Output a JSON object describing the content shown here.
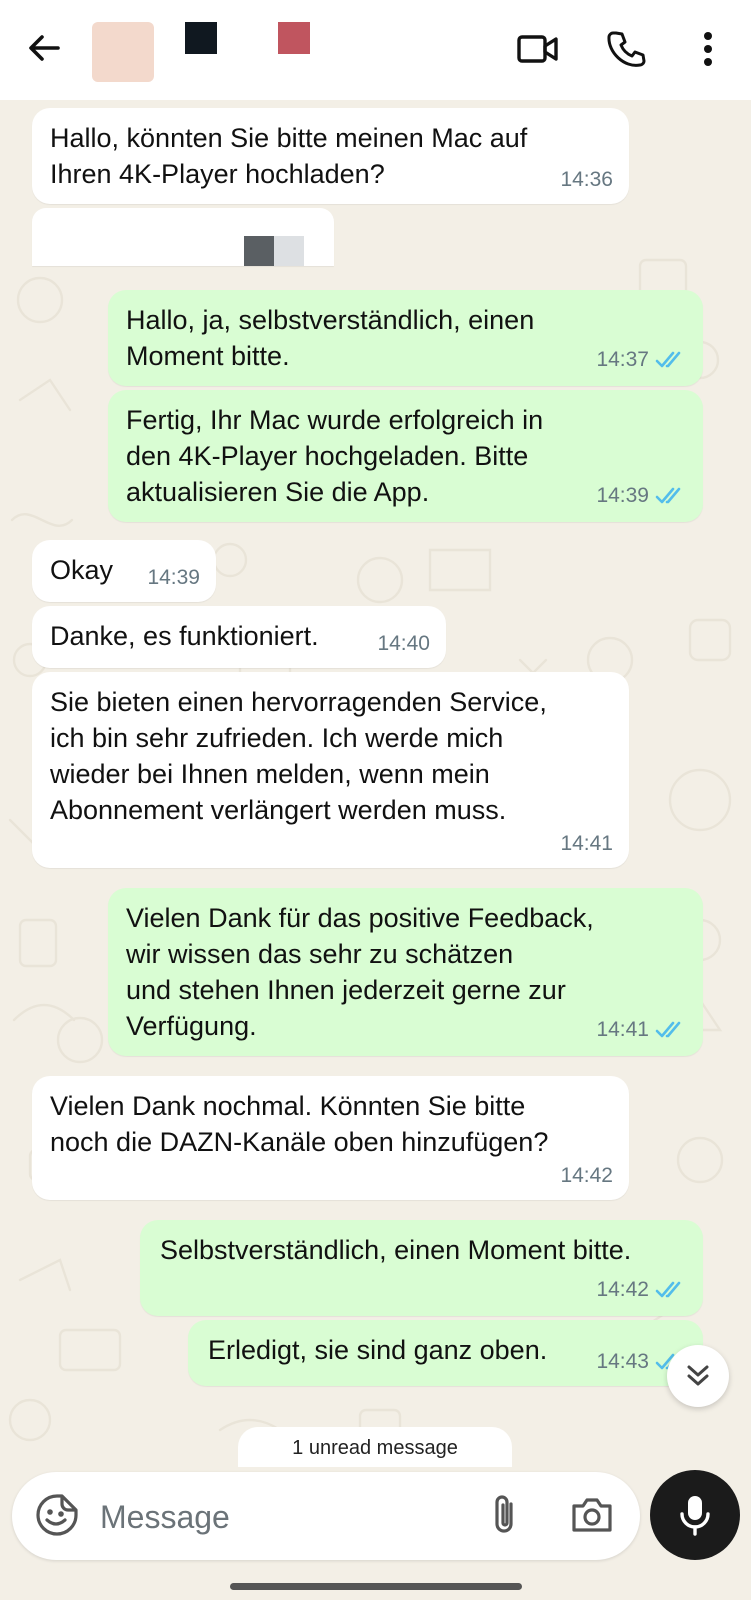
{
  "header": {
    "back_icon": "arrow-left-icon",
    "video_icon": "video-camera-icon",
    "call_icon": "phone-icon",
    "more_icon": "more-vertical-icon"
  },
  "messages": [
    {
      "type": "in",
      "text": "Hallo, könnten Sie bitte meinen Mac auf\nIhren 4K-Player hochladen?",
      "time": "14:36"
    },
    {
      "type": "in",
      "text": "",
      "time": "",
      "note": "redacted"
    },
    {
      "type": "out",
      "text": "Hallo, ja, selbstverständlich, einen\nMoment bitte.",
      "time": "14:37",
      "read": true
    },
    {
      "type": "out",
      "text": "Fertig, Ihr Mac wurde erfolgreich in\nden 4K-Player hochgeladen. Bitte\naktualisieren Sie die App.",
      "time": "14:39",
      "read": true
    },
    {
      "type": "in",
      "text": "Okay",
      "time": "14:39"
    },
    {
      "type": "in",
      "text": "Danke, es funktioniert.",
      "time": "14:40"
    },
    {
      "type": "in",
      "text": "Sie bieten einen hervorragenden Service,\nich bin sehr zufrieden. Ich werde mich\nwieder bei Ihnen melden, wenn mein\nAbonnement verlängert werden muss.",
      "time": "14:41"
    },
    {
      "type": "out",
      "text": "Vielen Dank für das positive Feedback,\nwir wissen das sehr zu schätzen\nund stehen Ihnen jederzeit gerne zur\nVerfügung.",
      "time": "14:41",
      "read": true
    },
    {
      "type": "in",
      "text": "Vielen Dank nochmal. Könnten Sie bitte\nnoch die DAZN-Kanäle oben hinzufügen?",
      "time": "14:42"
    },
    {
      "type": "out",
      "text": "Selbstverständlich, einen Moment bitte.",
      "time": "14:42",
      "read": true
    },
    {
      "type": "out",
      "text": "Erledigt, sie sind ganz oben.",
      "time": "14:43",
      "read": true
    }
  ],
  "unread_banner": "1 unread message",
  "composer": {
    "placeholder": "Message",
    "emoji_icon": "sticker-emoji-icon",
    "attach_icon": "paperclip-icon",
    "camera_icon": "camera-icon",
    "mic_icon": "microphone-icon"
  },
  "colors": {
    "incoming_bubble": "#ffffff",
    "outgoing_bubble": "#d9fdd3",
    "read_tick": "#53bdeb",
    "chat_background": "#f3efe6"
  }
}
